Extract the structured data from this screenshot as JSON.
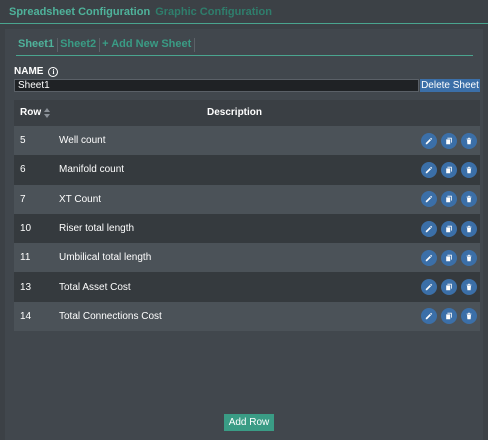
{
  "top_tabs": {
    "spreadsheet": "Spreadsheet Configuration",
    "graphic": "Graphic Configuration"
  },
  "sheet_tabs": {
    "sheet1": "Sheet1",
    "sheet2": "Sheet2",
    "add": "+ Add New Sheet"
  },
  "name_section": {
    "label": "NAME",
    "info_icon": "i",
    "value": "Sheet1",
    "delete_label": "Delete Sheet"
  },
  "table": {
    "columns": {
      "row": "Row",
      "description": "Description"
    },
    "rows": [
      {
        "row": "5",
        "description": "Well count"
      },
      {
        "row": "6",
        "description": "Manifold count"
      },
      {
        "row": "7",
        "description": "XT Count"
      },
      {
        "row": "10",
        "description": "Riser total length"
      },
      {
        "row": "11",
        "description": "Umbilical total length"
      },
      {
        "row": "13",
        "description": "Total Asset Cost"
      },
      {
        "row": "14",
        "description": "Total Connections Cost"
      }
    ],
    "row_actions": [
      "pencil-icon",
      "copy-icon",
      "trash-icon"
    ]
  },
  "add_row_label": "Add Row",
  "colors": {
    "accent": "#4fb39b",
    "button_blue": "#3b6fa8",
    "background": "#3c4146"
  }
}
